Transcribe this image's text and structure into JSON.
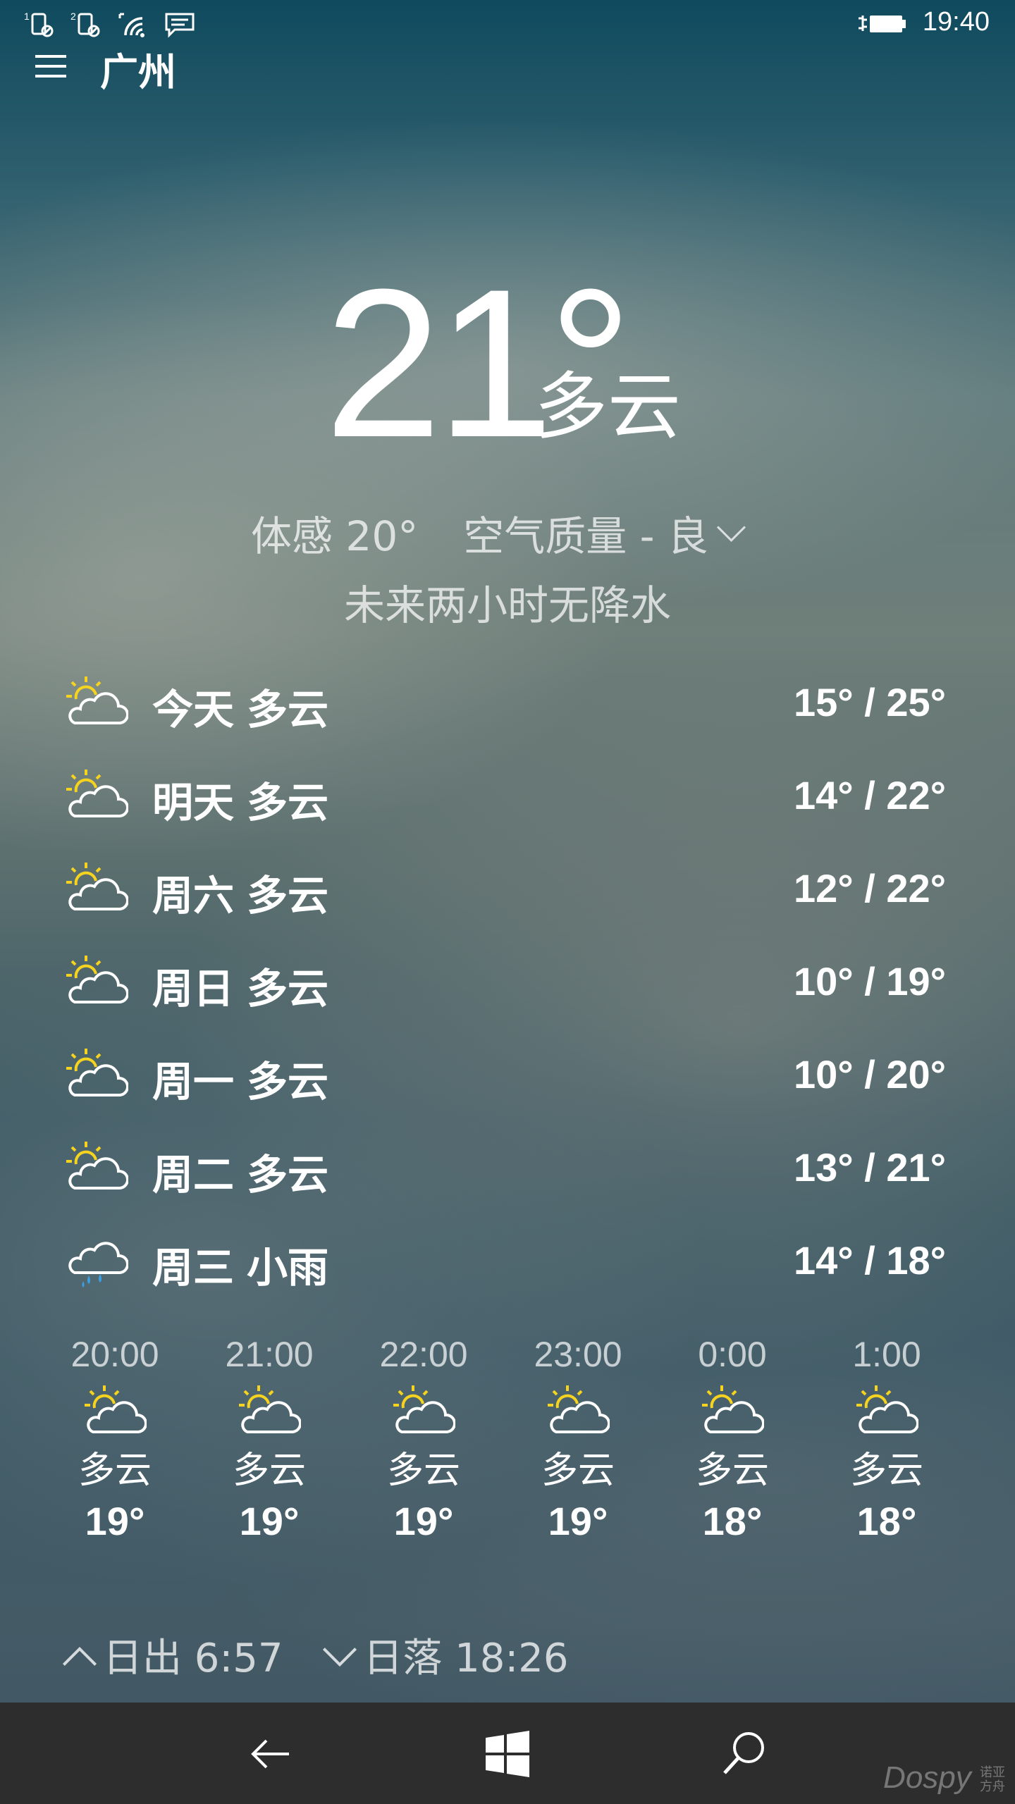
{
  "status_bar": {
    "time": "19:40",
    "sim1_label": "1",
    "sim2_label": "2",
    "icons": [
      "sim1-no-signal-icon",
      "sim2-no-signal-icon",
      "wifi-icon",
      "message-icon",
      "battery-charging-icon"
    ]
  },
  "header": {
    "menu_icon": "hamburger-menu-icon",
    "city": "广州"
  },
  "current": {
    "temperature": "21°",
    "condition": "多云",
    "feels_like": "体感 20°",
    "air_quality": "空气质量 - 良",
    "precip_note": "未来两小时无降水"
  },
  "daily": [
    {
      "day": "今天",
      "condition": "多云",
      "range": "15° / 25°",
      "icon": "partly-cloudy-icon"
    },
    {
      "day": "明天",
      "condition": "多云",
      "range": "14° / 22°",
      "icon": "partly-cloudy-icon"
    },
    {
      "day": "周六",
      "condition": "多云",
      "range": "12° / 22°",
      "icon": "partly-cloudy-icon"
    },
    {
      "day": "周日",
      "condition": "多云",
      "range": "10° / 19°",
      "icon": "partly-cloudy-icon"
    },
    {
      "day": "周一",
      "condition": "多云",
      "range": "10° / 20°",
      "icon": "partly-cloudy-icon"
    },
    {
      "day": "周二",
      "condition": "多云",
      "range": "13° / 21°",
      "icon": "partly-cloudy-icon"
    },
    {
      "day": "周三",
      "condition": "小雨",
      "range": "14° / 18°",
      "icon": "light-rain-icon"
    }
  ],
  "hourly": [
    {
      "time": "20:00",
      "condition": "多云",
      "temp": "19°",
      "icon": "partly-cloudy-icon"
    },
    {
      "time": "21:00",
      "condition": "多云",
      "temp": "19°",
      "icon": "partly-cloudy-icon"
    },
    {
      "time": "22:00",
      "condition": "多云",
      "temp": "19°",
      "icon": "partly-cloudy-icon"
    },
    {
      "time": "23:00",
      "condition": "多云",
      "temp": "19°",
      "icon": "partly-cloudy-icon"
    },
    {
      "time": "0:00",
      "condition": "多云",
      "temp": "18°",
      "icon": "partly-cloudy-icon"
    },
    {
      "time": "1:00",
      "condition": "多云",
      "temp": "18°",
      "icon": "partly-cloudy-icon"
    }
  ],
  "sun": {
    "sunrise": "日出 6:57",
    "sunset": "日落 18:26"
  },
  "nav": {
    "buttons": [
      "back-arrow-icon",
      "windows-start-icon",
      "search-icon"
    ]
  },
  "watermark": {
    "brand": "Dospy",
    "sub_line1": "诺亚",
    "sub_line2": "方舟"
  },
  "colors": {
    "sun": "#f5d31e",
    "rain": "#3aa0e6",
    "nav_bg": "#2d2d2d"
  }
}
